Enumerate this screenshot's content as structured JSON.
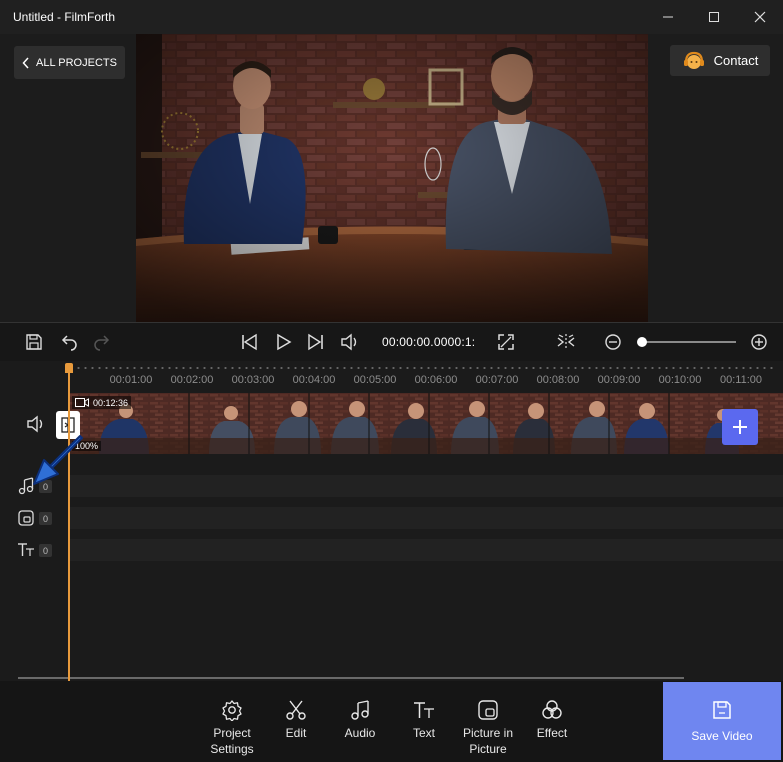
{
  "window": {
    "title": "Untitled - FilmForth",
    "minimize_glyph": "—",
    "maximize_glyph": "☐",
    "close_glyph": "✕"
  },
  "preview": {
    "back_label": "ALL PROJECTS",
    "contact_label": "Contact"
  },
  "toolbar": {
    "timecode": "00:00:00.0000:1:"
  },
  "timeline": {
    "ruler_ticks": [
      "00:01:00",
      "00:02:00",
      "00:03:00",
      "00:04:00",
      "00:05:00",
      "00:06:00",
      "00:07:00",
      "00:08:00",
      "00:09:00",
      "00:10:00",
      "00:11:00"
    ],
    "clip_duration": "00:12:36",
    "clip_volume": "100%",
    "tracks": [
      {
        "name": "audio",
        "count": "0"
      },
      {
        "name": "picture-in-picture",
        "count": "0"
      },
      {
        "name": "text",
        "count": "0"
      }
    ]
  },
  "bottom_tools": [
    {
      "label": "Project Settings",
      "icon": "gear-icon"
    },
    {
      "label": "Edit",
      "icon": "scissors-icon"
    },
    {
      "label": "Audio",
      "icon": "music-note-icon"
    },
    {
      "label": "Text",
      "icon": "text-icon"
    },
    {
      "label": "Picture in Picture",
      "icon": "pip-icon"
    },
    {
      "label": "Effect",
      "icon": "effect-icon"
    }
  ],
  "save_label": "Save Video",
  "colors": {
    "accent": "#6f86f0",
    "add_button": "#5b69ef",
    "playhead": "#e89a3c",
    "arrow": "#2f6fd6"
  }
}
